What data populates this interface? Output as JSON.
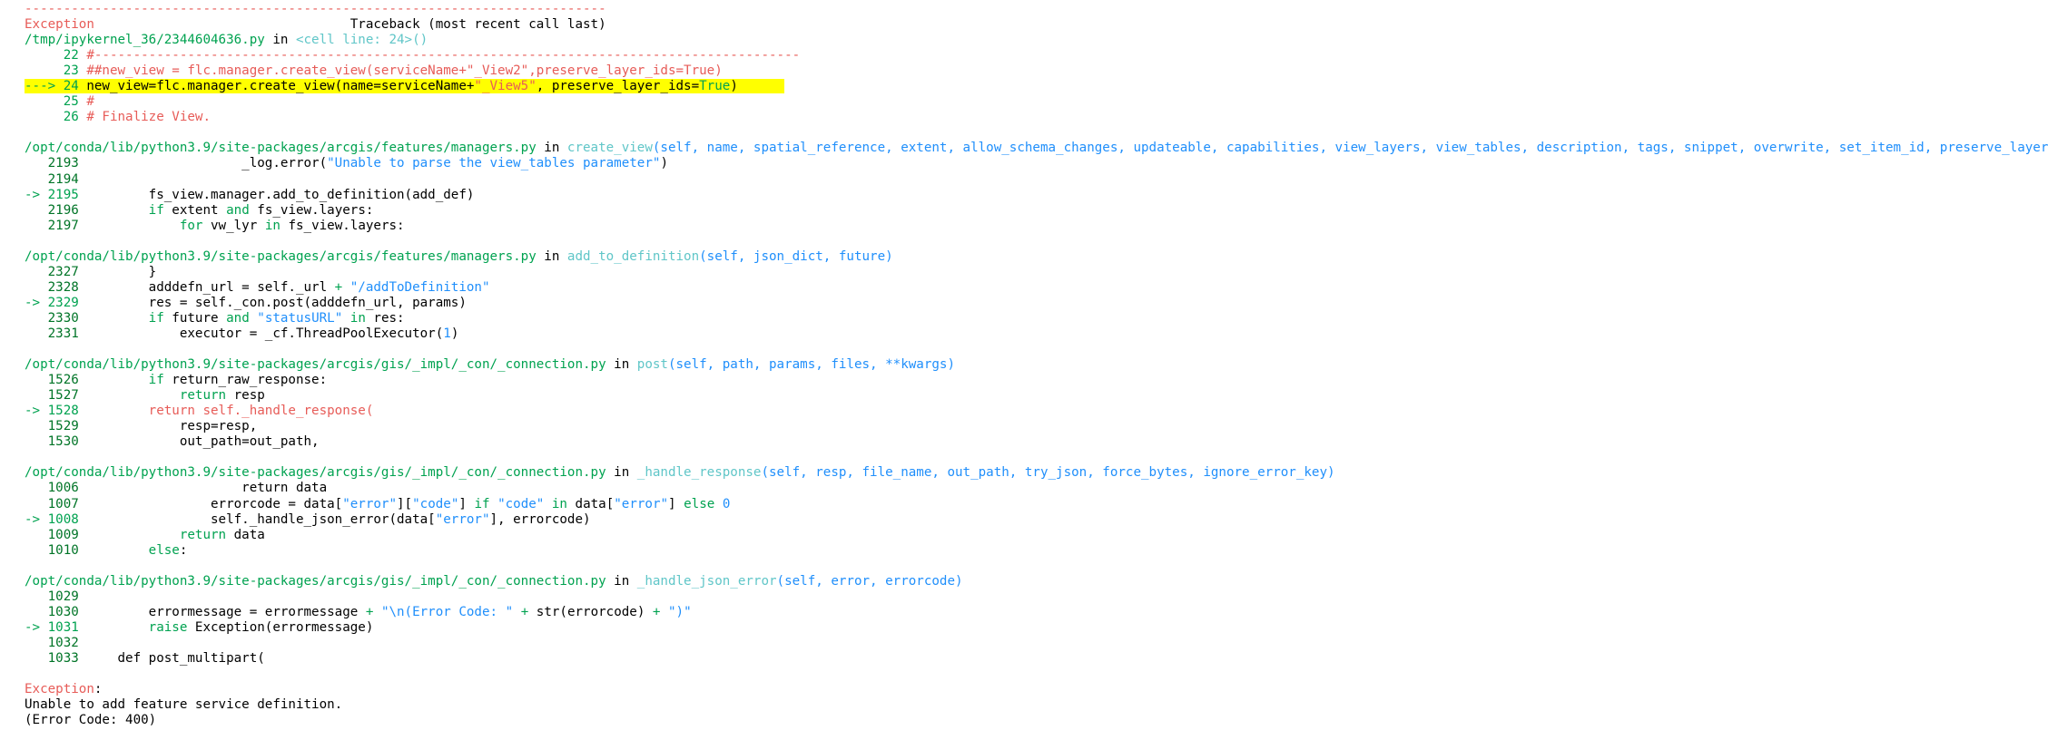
{
  "colors": {
    "red": "#e75c58",
    "green": "#00a250",
    "bold_green": "#007427",
    "cyan": "#60c6c8",
    "blue": "#208ffb",
    "plain": "#000000",
    "highlight": "#ffff00"
  },
  "traceback": {
    "lines": [
      {
        "name": "separator",
        "segments": [
          {
            "c": "red",
            "t": "---------------------------------------------------------------------------"
          }
        ]
      },
      {
        "name": "header",
        "segments": [
          {
            "c": "red",
            "t": "Exception"
          },
          {
            "c": "plain",
            "t": "                                 Traceback (most recent call last)"
          }
        ]
      },
      {
        "name": "frame-0-path",
        "segments": [
          {
            "c": "green",
            "t": "/tmp/ipykernel_36/2344604636.py"
          },
          {
            "c": "plain",
            "t": " in "
          },
          {
            "c": "cyan",
            "t": "<cell line: 24>"
          },
          {
            "c": "cyan",
            "t": "()"
          }
        ]
      },
      {
        "name": "code-line",
        "segments": [
          {
            "c": "green",
            "t": "     22"
          },
          {
            "c": "plain",
            "t": " "
          },
          {
            "c": "red",
            "t": "#-------------------------------------------------------------------------------------------"
          }
        ]
      },
      {
        "name": "code-line",
        "segments": [
          {
            "c": "green",
            "t": "     23"
          },
          {
            "c": "plain",
            "t": " "
          },
          {
            "c": "red",
            "t": "##new_view = flc.manager.create_view(serviceName+\"_View2\",preserve_layer_ids=True)"
          }
        ]
      },
      {
        "name": "code-line-current",
        "highlight": true,
        "segments": [
          {
            "c": "green",
            "t": "---> 24"
          },
          {
            "c": "plain",
            "t": " new_view=flc.manager.create_view(name=serviceName+"
          },
          {
            "c": "red",
            "t": "\"_View5\""
          },
          {
            "c": "plain",
            "t": ", preserve_layer_ids="
          },
          {
            "c": "green",
            "t": "True"
          },
          {
            "c": "plain",
            "t": ")      "
          }
        ]
      },
      {
        "name": "code-line",
        "segments": [
          {
            "c": "green",
            "t": "     25"
          },
          {
            "c": "plain",
            "t": " "
          },
          {
            "c": "red",
            "t": "#"
          }
        ]
      },
      {
        "name": "code-line",
        "segments": [
          {
            "c": "green",
            "t": "     26"
          },
          {
            "c": "plain",
            "t": " "
          },
          {
            "c": "red",
            "t": "# Finalize View."
          }
        ]
      },
      {
        "name": "blank",
        "segments": []
      },
      {
        "name": "frame-1-path",
        "segments": [
          {
            "c": "green",
            "t": "/opt/conda/lib/python3.9/site-packages/arcgis/features/managers.py"
          },
          {
            "c": "plain",
            "t": " in "
          },
          {
            "c": "cyan",
            "t": "create_view"
          },
          {
            "c": "blue",
            "t": "(self, name, spatial_reference, extent, allow_schema_changes, updateable, capabilities, view_layers, view_tables, description, tags, snippet, overwrite, set_item_id, preserve_layer_ids)"
          }
        ]
      },
      {
        "name": "code-line",
        "segments": [
          {
            "c": "bold_green",
            "t": "   2193"
          },
          {
            "c": "plain",
            "t": "                     _log.error("
          },
          {
            "c": "blue",
            "t": "\"Unable to parse the view_tables parameter\""
          },
          {
            "c": "plain",
            "t": ")"
          }
        ]
      },
      {
        "name": "code-line",
        "segments": [
          {
            "c": "bold_green",
            "t": "   2194"
          }
        ]
      },
      {
        "name": "code-line-current",
        "segments": [
          {
            "c": "green",
            "t": "-> 2195"
          },
          {
            "c": "plain",
            "t": "         fs_view.manager.add_to_definition(add_def)"
          }
        ]
      },
      {
        "name": "code-line",
        "segments": [
          {
            "c": "bold_green",
            "t": "   2196"
          },
          {
            "c": "plain",
            "t": "         "
          },
          {
            "c": "green",
            "t": "if"
          },
          {
            "c": "plain",
            "t": " extent "
          },
          {
            "c": "green",
            "t": "and"
          },
          {
            "c": "plain",
            "t": " fs_view.layers:"
          }
        ]
      },
      {
        "name": "code-line",
        "segments": [
          {
            "c": "bold_green",
            "t": "   2197"
          },
          {
            "c": "plain",
            "t": "             "
          },
          {
            "c": "green",
            "t": "for"
          },
          {
            "c": "plain",
            "t": " vw_lyr "
          },
          {
            "c": "green",
            "t": "in"
          },
          {
            "c": "plain",
            "t": " fs_view.layers:"
          }
        ]
      },
      {
        "name": "blank",
        "segments": []
      },
      {
        "name": "frame-2-path",
        "segments": [
          {
            "c": "green",
            "t": "/opt/conda/lib/python3.9/site-packages/arcgis/features/managers.py"
          },
          {
            "c": "plain",
            "t": " in "
          },
          {
            "c": "cyan",
            "t": "add_to_definition"
          },
          {
            "c": "blue",
            "t": "(self, json_dict, future)"
          }
        ]
      },
      {
        "name": "code-line",
        "segments": [
          {
            "c": "bold_green",
            "t": "   2327"
          },
          {
            "c": "plain",
            "t": "         }"
          }
        ]
      },
      {
        "name": "code-line",
        "segments": [
          {
            "c": "bold_green",
            "t": "   2328"
          },
          {
            "c": "plain",
            "t": "         adddefn_url = self._url "
          },
          {
            "c": "green",
            "t": "+"
          },
          {
            "c": "plain",
            "t": " "
          },
          {
            "c": "blue",
            "t": "\"/addToDefinition\""
          }
        ]
      },
      {
        "name": "code-line-current",
        "segments": [
          {
            "c": "green",
            "t": "-> 2329"
          },
          {
            "c": "plain",
            "t": "         res = self._con.post(adddefn_url, params)"
          }
        ]
      },
      {
        "name": "code-line",
        "segments": [
          {
            "c": "bold_green",
            "t": "   2330"
          },
          {
            "c": "plain",
            "t": "         "
          },
          {
            "c": "green",
            "t": "if"
          },
          {
            "c": "plain",
            "t": " future "
          },
          {
            "c": "green",
            "t": "and"
          },
          {
            "c": "plain",
            "t": " "
          },
          {
            "c": "blue",
            "t": "\"statusURL\""
          },
          {
            "c": "plain",
            "t": " "
          },
          {
            "c": "green",
            "t": "in"
          },
          {
            "c": "plain",
            "t": " res:"
          }
        ]
      },
      {
        "name": "code-line",
        "segments": [
          {
            "c": "bold_green",
            "t": "   2331"
          },
          {
            "c": "plain",
            "t": "             executor = _cf.ThreadPoolExecutor("
          },
          {
            "c": "blue",
            "t": "1"
          },
          {
            "c": "plain",
            "t": ")"
          }
        ]
      },
      {
        "name": "blank",
        "segments": []
      },
      {
        "name": "frame-3-path",
        "segments": [
          {
            "c": "green",
            "t": "/opt/conda/lib/python3.9/site-packages/arcgis/gis/_impl/_con/_connection.py"
          },
          {
            "c": "plain",
            "t": " in "
          },
          {
            "c": "cyan",
            "t": "post"
          },
          {
            "c": "blue",
            "t": "(self, path, params, files, **kwargs)"
          }
        ]
      },
      {
        "name": "code-line",
        "segments": [
          {
            "c": "bold_green",
            "t": "   1526"
          },
          {
            "c": "plain",
            "t": "         "
          },
          {
            "c": "green",
            "t": "if"
          },
          {
            "c": "plain",
            "t": " return_raw_response:"
          }
        ]
      },
      {
        "name": "code-line",
        "segments": [
          {
            "c": "bold_green",
            "t": "   1527"
          },
          {
            "c": "plain",
            "t": "             "
          },
          {
            "c": "green",
            "t": "return"
          },
          {
            "c": "plain",
            "t": " resp"
          }
        ]
      },
      {
        "name": "code-line-current",
        "segments": [
          {
            "c": "green",
            "t": "-> 1528"
          },
          {
            "c": "plain",
            "t": "         "
          },
          {
            "c": "red",
            "t": "return self._handle_response("
          }
        ]
      },
      {
        "name": "code-line",
        "segments": [
          {
            "c": "bold_green",
            "t": "   1529"
          },
          {
            "c": "plain",
            "t": "             resp=resp,"
          }
        ]
      },
      {
        "name": "code-line",
        "segments": [
          {
            "c": "bold_green",
            "t": "   1530"
          },
          {
            "c": "plain",
            "t": "             out_path=out_path,"
          }
        ]
      },
      {
        "name": "blank",
        "segments": []
      },
      {
        "name": "frame-4-path",
        "segments": [
          {
            "c": "green",
            "t": "/opt/conda/lib/python3.9/site-packages/arcgis/gis/_impl/_con/_connection.py"
          },
          {
            "c": "plain",
            "t": " in "
          },
          {
            "c": "cyan",
            "t": "_handle_response"
          },
          {
            "c": "blue",
            "t": "(self, resp, file_name, out_path, try_json, force_bytes, ignore_error_key)"
          }
        ]
      },
      {
        "name": "code-line",
        "segments": [
          {
            "c": "bold_green",
            "t": "   1006"
          },
          {
            "c": "plain",
            "t": "                     return data"
          }
        ]
      },
      {
        "name": "code-line",
        "segments": [
          {
            "c": "bold_green",
            "t": "   1007"
          },
          {
            "c": "plain",
            "t": "                 errorcode = data["
          },
          {
            "c": "blue",
            "t": "\"error\""
          },
          {
            "c": "plain",
            "t": "]["
          },
          {
            "c": "blue",
            "t": "\"code\""
          },
          {
            "c": "plain",
            "t": "] "
          },
          {
            "c": "green",
            "t": "if"
          },
          {
            "c": "plain",
            "t": " "
          },
          {
            "c": "blue",
            "t": "\"code\""
          },
          {
            "c": "plain",
            "t": " "
          },
          {
            "c": "green",
            "t": "in"
          },
          {
            "c": "plain",
            "t": " data["
          },
          {
            "c": "blue",
            "t": "\"error\""
          },
          {
            "c": "plain",
            "t": "] "
          },
          {
            "c": "green",
            "t": "else"
          },
          {
            "c": "plain",
            "t": " "
          },
          {
            "c": "blue",
            "t": "0"
          }
        ]
      },
      {
        "name": "code-line-current",
        "segments": [
          {
            "c": "green",
            "t": "-> 1008"
          },
          {
            "c": "plain",
            "t": "                 self._handle_json_error(data["
          },
          {
            "c": "blue",
            "t": "\"error\""
          },
          {
            "c": "plain",
            "t": "], errorcode)"
          }
        ]
      },
      {
        "name": "code-line",
        "segments": [
          {
            "c": "bold_green",
            "t": "   1009"
          },
          {
            "c": "plain",
            "t": "             "
          },
          {
            "c": "green",
            "t": "return"
          },
          {
            "c": "plain",
            "t": " data"
          }
        ]
      },
      {
        "name": "code-line",
        "segments": [
          {
            "c": "bold_green",
            "t": "   1010"
          },
          {
            "c": "plain",
            "t": "         "
          },
          {
            "c": "green",
            "t": "else"
          },
          {
            "c": "plain",
            "t": ":"
          }
        ]
      },
      {
        "name": "blank",
        "segments": []
      },
      {
        "name": "frame-5-path",
        "segments": [
          {
            "c": "green",
            "t": "/opt/conda/lib/python3.9/site-packages/arcgis/gis/_impl/_con/_connection.py"
          },
          {
            "c": "plain",
            "t": " in "
          },
          {
            "c": "cyan",
            "t": "_handle_json_error"
          },
          {
            "c": "blue",
            "t": "(self, error, errorcode)"
          }
        ]
      },
      {
        "name": "code-line",
        "segments": [
          {
            "c": "bold_green",
            "t": "   1029"
          }
        ]
      },
      {
        "name": "code-line",
        "segments": [
          {
            "c": "bold_green",
            "t": "   1030"
          },
          {
            "c": "plain",
            "t": "         errormessage = errormessage "
          },
          {
            "c": "green",
            "t": "+"
          },
          {
            "c": "plain",
            "t": " "
          },
          {
            "c": "blue",
            "t": "\"\\n(Error Code: \""
          },
          {
            "c": "plain",
            "t": " "
          },
          {
            "c": "green",
            "t": "+"
          },
          {
            "c": "plain",
            "t": " str(errorcode) "
          },
          {
            "c": "green",
            "t": "+"
          },
          {
            "c": "plain",
            "t": " "
          },
          {
            "c": "blue",
            "t": "\")\""
          }
        ]
      },
      {
        "name": "code-line-current",
        "segments": [
          {
            "c": "green",
            "t": "-> 1031"
          },
          {
            "c": "plain",
            "t": "         "
          },
          {
            "c": "green",
            "t": "raise"
          },
          {
            "c": "plain",
            "t": " Exception(errormessage)"
          }
        ]
      },
      {
        "name": "code-line",
        "segments": [
          {
            "c": "bold_green",
            "t": "   1032"
          }
        ]
      },
      {
        "name": "code-line",
        "segments": [
          {
            "c": "bold_green",
            "t": "   1033"
          },
          {
            "c": "plain",
            "t": "     def post_multipart("
          }
        ]
      },
      {
        "name": "blank",
        "segments": []
      },
      {
        "name": "exception-name",
        "segments": [
          {
            "c": "red",
            "t": "Exception"
          },
          {
            "c": "plain",
            "t": ":"
          }
        ]
      },
      {
        "name": "exception-message",
        "segments": [
          {
            "c": "plain",
            "t": "Unable to add feature service definition."
          }
        ]
      },
      {
        "name": "exception-code",
        "segments": [
          {
            "c": "plain",
            "t": "(Error Code: 400)"
          }
        ]
      }
    ]
  }
}
